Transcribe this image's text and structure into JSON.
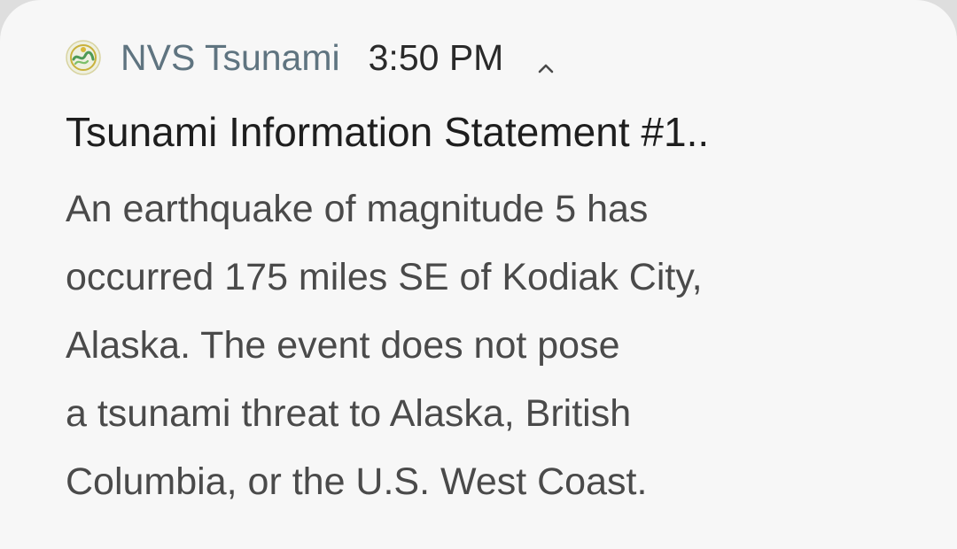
{
  "notification": {
    "app_icon": "nvs-tsunami-app-icon",
    "app_name": "NVS Tsunami",
    "time": "3:50 PM",
    "expand_icon": "chevron-up-icon",
    "title": "Tsunami Information Statement #1..",
    "body_lines": [
      "An earthquake of magnitude 5 has",
      "occurred 175 miles SE of Kodiak City,",
      "Alaska. The event does not pose",
      "a tsunami threat to Alaska, British",
      "Columbia, or the U.S. West Coast."
    ],
    "colors": {
      "background": "#f7f7f7",
      "app_name": "#5f7480",
      "time": "#2a2a2a",
      "title": "#1e1e1e",
      "body": "#4a4a4a",
      "icon_gold": "#c9b13c",
      "icon_green": "#4e9a55"
    }
  }
}
